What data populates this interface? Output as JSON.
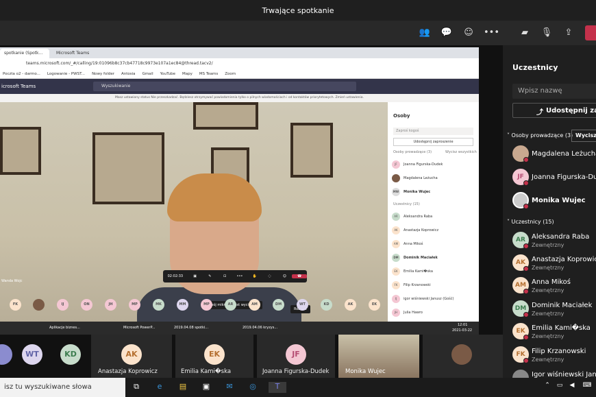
{
  "window_title": "Trwające spotkanie",
  "browser": {
    "tab1": "spotkanie (Spotk...",
    "tab2": "Microsoft Teams",
    "url": "teams.microsoft.com/_#/calling/19:01096b8c37cb47718c9973e107a1ec84@thread.tacv2/",
    "bookmarks": [
      "Poczta o2 - darmo...",
      "Logowanie - PWST...",
      "Nowy folder",
      "Antosia",
      "Gmail",
      "YouTube",
      "Mapy",
      "MS Teams",
      "Zoom"
    ]
  },
  "teams_inner": {
    "app_name": "icrosoft Teams",
    "search_placeholder": "Wyszukiwanie",
    "notice": "Masz ustawiony status Nie przeszkadzać. Będziesz otrzymywać powiadomienia tylko o pilnych wiadomościach i od kontaktów priorytetowych. Zmień ustawienia.",
    "timer": "02:02:33",
    "mic_tooltip": "Twój mikrofon jest wyciszony.",
    "leave_tooltip": "Rozłącz",
    "avatar_row": [
      "FK",
      "",
      "IJ",
      "ON",
      "JH",
      "MP",
      "MK",
      "MM",
      "MP",
      "AR",
      "AM",
      "DM",
      "WT",
      "KD",
      "AK",
      "EK"
    ],
    "caller_name": "Wanda Wojc",
    "people_panel": {
      "title": "Osoby",
      "invite_placeholder": "Zaproś kogoś",
      "share_button": "Udostępnij zaproszenie",
      "presenters_header": "Osoby prowadzące (3)",
      "mute_all": "Wycisz wszystkich",
      "presenters": [
        {
          "initials": "JF",
          "name": "Joanna Figurska-Dudek"
        },
        {
          "initials": "",
          "name": "Magdalena Leżucha"
        },
        {
          "initials": "MW",
          "name": "Monika Wujec"
        }
      ],
      "attendees_header": "Uczestnicy (15)",
      "attendees": [
        {
          "initials": "AR",
          "name": "Aleksandra Raba"
        },
        {
          "initials": "AK",
          "name": "Anastazja Koprowicz"
        },
        {
          "initials": "AM",
          "name": "Anna Mikoś"
        },
        {
          "initials": "DM",
          "name": "Dominik Maciałek"
        },
        {
          "initials": "EK",
          "name": "Emilia Kami�ska"
        },
        {
          "initials": "FK",
          "name": "Filip Krzanowski"
        },
        {
          "initials": "IJ",
          "name": "igor wiśniewski Janusz (Gość)"
        },
        {
          "initials": "JH",
          "name": "Julia Hawro"
        }
      ]
    },
    "taskbar_items": [
      "Aplikacje biznes...",
      "Microsoft PowerP...",
      "2019.04.08 spotki...",
      "2019.04.06 kryzys..."
    ],
    "clock": "12:01",
    "date": "2021-03-22"
  },
  "right_panel": {
    "title": "Uczestnicy",
    "search_placeholder": "Wpisz nazwę",
    "share_button": "Udostępnij zapro",
    "presenters_header": "Osoby prowadzące (3)",
    "mute_button": "Wycisz",
    "presenters": [
      {
        "initials": "",
        "name": "Magdalena Leżucha",
        "color": "#c8a88f"
      },
      {
        "initials": "JF",
        "name": "Joanna Figurska-Dudek",
        "color": "#f4c7d3"
      },
      {
        "initials": "",
        "name": "Monika Wujec",
        "color": "#cccccc"
      }
    ],
    "attendees_header": "Uczestnicy (15)",
    "external_label": "Zewnętrzny",
    "attendees": [
      {
        "initials": "AR",
        "name": "Aleksandra Raba",
        "color": "#c7dccb"
      },
      {
        "initials": "AK",
        "name": "Anastazja Koprowicz",
        "color": "#fbe3cc"
      },
      {
        "initials": "AM",
        "name": "Anna Mikoś",
        "color": "#fbe3cc"
      },
      {
        "initials": "DM",
        "name": "Dominik Maciałek",
        "color": "#c7dccb"
      },
      {
        "initials": "EK",
        "name": "Emilia Kami�ska",
        "color": "#fbe3cc"
      },
      {
        "initials": "FK",
        "name": "Filip Krzanowski",
        "color": "#fbe3cc"
      },
      {
        "initials": "",
        "name": "Igor wiśniewski Janusz",
        "color": "#888888"
      }
    ]
  },
  "strip": [
    {
      "initials": "WT",
      "name": "",
      "color": "#ddd6ee"
    },
    {
      "initials": "KD",
      "name": "",
      "color": "#c7dccb"
    },
    {
      "initials": "AK",
      "name": "Anastazja Koprowicz",
      "color": "#fbe3cc"
    },
    {
      "initials": "EK",
      "name": "Emilia Kami�ska",
      "color": "#fbe3cc"
    },
    {
      "initials": "JF",
      "name": "Joanna Figurska-Dudek",
      "color": "#f4c7d3"
    },
    {
      "initials": "",
      "name": "Monika Wujec",
      "color": "#8a7560"
    }
  ],
  "taskbar": {
    "search_placeholder": "isz tu wyszukiwane słowa"
  }
}
